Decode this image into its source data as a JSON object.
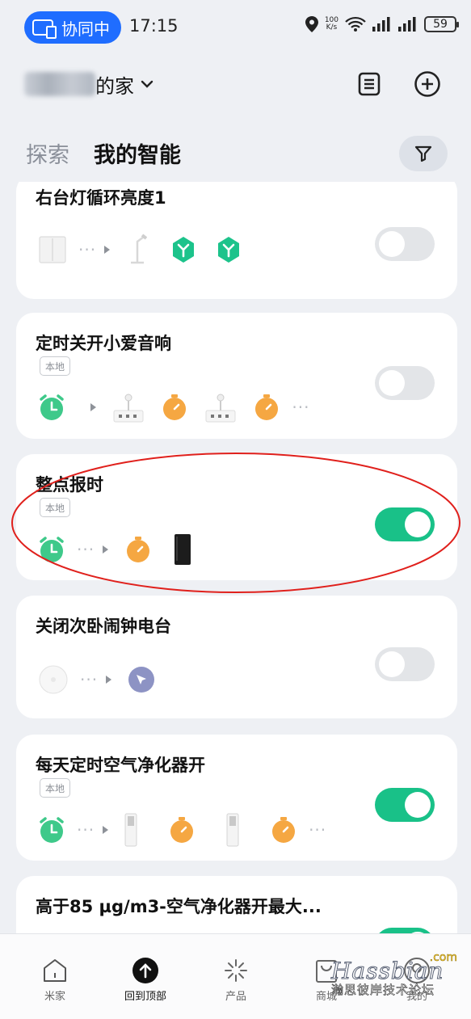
{
  "status_bar": {
    "collab_label": "协同中",
    "time": "17:15",
    "speed_value": "100",
    "speed_unit": "K/s",
    "battery": "59"
  },
  "header": {
    "home_suffix": "的家",
    "tabs": [
      {
        "label": "探索",
        "active": false
      },
      {
        "label": "我的智能",
        "active": true
      }
    ]
  },
  "scenes": [
    {
      "title": "右台灯循环亮度1",
      "badge": "",
      "enabled": false
    },
    {
      "title": "定时关开小爱音响",
      "badge": "本地",
      "enabled": false
    },
    {
      "title": "整点报时",
      "badge": "本地",
      "enabled": true
    },
    {
      "title": "关闭次卧闹钟电台",
      "badge": "",
      "enabled": false
    },
    {
      "title": "每天定时空气净化器开",
      "badge": "本地",
      "enabled": true
    },
    {
      "title": "高于85 µg/m3-空气净化器开最大...",
      "badge": "",
      "enabled": true
    }
  ],
  "bottom_nav": [
    {
      "label": "米家",
      "icon": "home-icon"
    },
    {
      "label": "回到顶部",
      "icon": "arrow-up-icon"
    },
    {
      "label": "产品",
      "icon": "sparkle-icon"
    },
    {
      "label": "商城",
      "icon": "bag-icon"
    },
    {
      "label": "我的",
      "icon": "profile-icon"
    }
  ],
  "watermark": {
    "en": "Hassbian",
    "com": ".com",
    "cn": "瀚思彼岸技术论坛"
  },
  "colors": {
    "accent_blue": "#1f6dff",
    "toggle_on": "#19c188",
    "alarm_green": "#3ec98a",
    "timer_orange": "#f5a742",
    "hex_green": "#1cc38b",
    "highlight_red": "#e0201c"
  }
}
